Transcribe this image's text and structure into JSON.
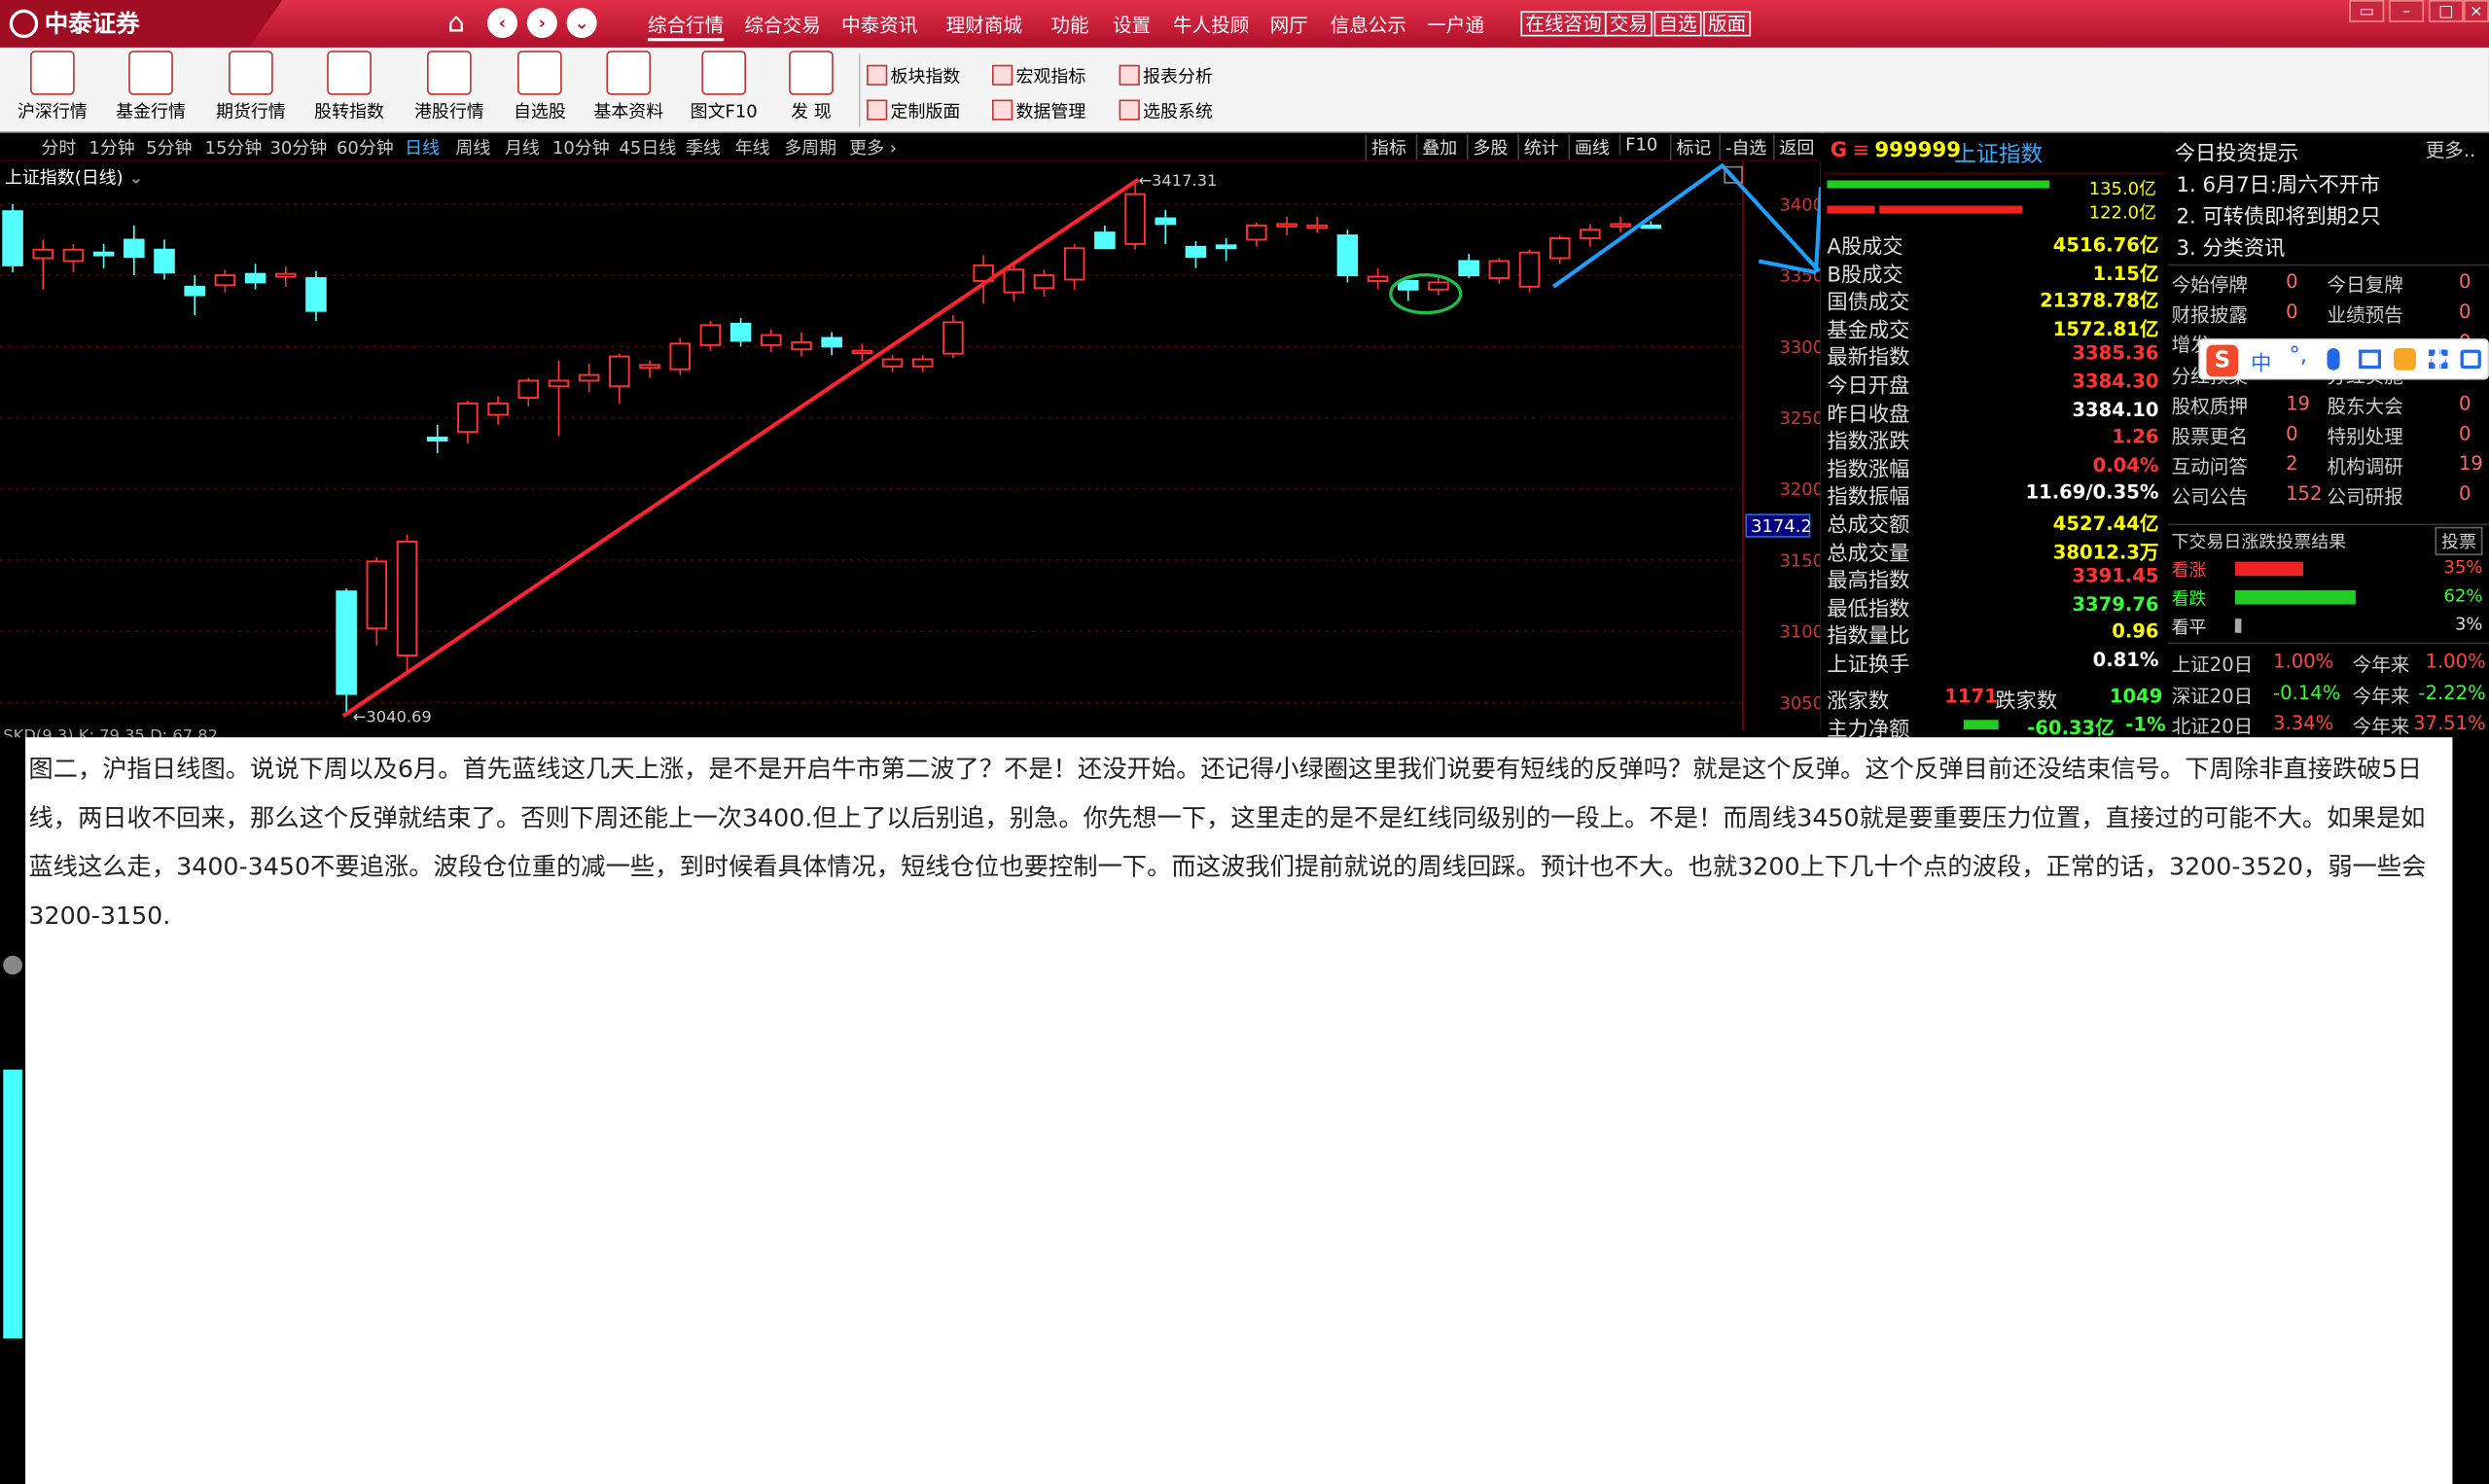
{
  "titlebar": {
    "logo": "中泰证券",
    "menu": [
      "综合行情",
      "综合交易",
      "中泰资讯",
      "理财商城",
      "功能",
      "设置",
      "牛人投顾",
      "网厅",
      "信息公示",
      "一户通"
    ],
    "menu_active": "综合行情",
    "boxes": [
      "在线咨询",
      "交易",
      "自选",
      "版面"
    ],
    "nav_icons": [
      "home-icon",
      "back-icon",
      "forward-icon",
      "dropdown-icon"
    ]
  },
  "toolbar": {
    "items": [
      "沪深行情",
      "基金行情",
      "期货行情",
      "股转指数",
      "港股行情",
      "自选股",
      "基本资料",
      "图文F10",
      "发  现"
    ],
    "items2": [
      "板块指数",
      "宏观指标",
      "报表分析",
      "定制版面",
      "数据管理",
      "选股系统"
    ]
  },
  "chartbar": {
    "timeframes": [
      "分时",
      "1分钟",
      "5分钟",
      "15分钟",
      "30分钟",
      "60分钟",
      "日线",
      "周线",
      "月线",
      "10分钟",
      "45日线",
      "季线",
      "年线",
      "多周期",
      "更多"
    ],
    "active": "日线",
    "tools": [
      "指标",
      "叠加",
      "多股",
      "统计",
      "画线",
      "F10",
      "标记",
      "-自选",
      "返回"
    ]
  },
  "chart": {
    "title": "上证指数(日线)",
    "high_label": "3417.31",
    "low_label": "3040.69",
    "current_price": "3174.2",
    "y_ticks": [
      "3400",
      "3350",
      "3300",
      "3250",
      "3200",
      "3150",
      "3100",
      "3050"
    ],
    "sub_label": "SKD(9,3) K: 79.35 D: 67.82"
  },
  "chart_data": {
    "type": "candlestick",
    "title": "上证指数(日线)",
    "ylim": [
      3030,
      3430
    ],
    "y_ticks": [
      3400,
      3350,
      3300,
      3250,
      3200,
      3150,
      3100,
      3050
    ],
    "candles": [
      [
        3395,
        3357,
        3400,
        3352
      ],
      [
        3362,
        3368,
        3375,
        3340
      ],
      [
        3360,
        3368,
        3372,
        3352
      ],
      [
        3366,
        3364,
        3372,
        3355
      ],
      [
        3375,
        3363,
        3385,
        3350
      ],
      [
        3368,
        3352,
        3375,
        3347
      ],
      [
        3342,
        3336,
        3350,
        3322
      ],
      [
        3343,
        3350,
        3354,
        3338
      ],
      [
        3351,
        3345,
        3358,
        3340
      ],
      [
        3349,
        3351,
        3356,
        3342
      ],
      [
        3348,
        3325,
        3353,
        3318
      ],
      [
        3128,
        3056,
        3130,
        3040.69
      ],
      [
        3102,
        3149,
        3152,
        3090
      ],
      [
        3083,
        3163,
        3168,
        3070
      ],
      [
        3236,
        3234,
        3245,
        3225
      ],
      [
        3240,
        3260,
        3262,
        3232
      ],
      [
        3252,
        3260,
        3265,
        3245
      ],
      [
        3264,
        3276,
        3278,
        3258
      ],
      [
        3272,
        3276,
        3290,
        3237
      ],
      [
        3276,
        3280,
        3288,
        3268
      ],
      [
        3272,
        3293,
        3295,
        3260
      ],
      [
        3285,
        3287,
        3290,
        3278
      ],
      [
        3284,
        3302,
        3306,
        3280
      ],
      [
        3301,
        3315,
        3318,
        3297
      ],
      [
        3316,
        3304,
        3320,
        3300
      ],
      [
        3301,
        3308,
        3312,
        3296
      ],
      [
        3298,
        3303,
        3310,
        3293
      ],
      [
        3306,
        3300,
        3310,
        3294
      ],
      [
        3296,
        3297,
        3302,
        3290
      ],
      [
        3286,
        3291,
        3294,
        3282
      ],
      [
        3286,
        3291,
        3294,
        3282
      ],
      [
        3295,
        3317,
        3322,
        3292
      ],
      [
        3346,
        3357,
        3364,
        3330
      ],
      [
        3338,
        3354,
        3360,
        3332
      ],
      [
        3341,
        3350,
        3354,
        3335
      ],
      [
        3347,
        3369,
        3372,
        3340
      ],
      [
        3380,
        3369,
        3385,
        3374
      ],
      [
        3372,
        3407,
        3417.31,
        3368
      ],
      [
        3390,
        3386,
        3396,
        3372
      ],
      [
        3370,
        3363,
        3374,
        3355
      ],
      [
        3371,
        3369,
        3376,
        3360
      ],
      [
        3375,
        3385,
        3387,
        3370
      ],
      [
        3385,
        3386,
        3391,
        3378
      ],
      [
        3384,
        3385,
        3391,
        3380
      ],
      [
        3378,
        3350,
        3382,
        3345
      ],
      [
        3346,
        3349,
        3355,
        3340
      ],
      [
        3346,
        3340,
        3346,
        3332
      ],
      [
        3340,
        3345,
        3349,
        3336
      ],
      [
        3360,
        3350,
        3365,
        3348
      ],
      [
        3348,
        3360,
        3362,
        3344
      ],
      [
        3342,
        3366,
        3368,
        3338
      ],
      [
        3362,
        3376,
        3378,
        3358
      ],
      [
        3376,
        3382,
        3386,
        3370
      ],
      [
        3385,
        3386,
        3391,
        3380
      ],
      [
        3385,
        3384,
        3388,
        3383
      ]
    ]
  },
  "info": {
    "code": "999999",
    "name": "上证指数",
    "bar1": "135.0亿",
    "bar2": "122.0亿",
    "rows": [
      [
        "A股成交",
        "4516.76亿",
        "#ff0"
      ],
      [
        "B股成交",
        "1.15亿",
        "#ff0"
      ],
      [
        "国债成交",
        "21378.78亿",
        "#ff0"
      ],
      [
        "基金成交",
        "1572.81亿",
        "#ff0"
      ],
      [
        "最新指数",
        "3385.36",
        "#f33"
      ],
      [
        "今日开盘",
        "3384.30",
        "#f33"
      ],
      [
        "昨日收盘",
        "3384.10",
        "#fff"
      ],
      [
        "指数涨跌",
        "1.26",
        "#f33"
      ],
      [
        "指数涨幅",
        "0.04%",
        "#f33"
      ],
      [
        "指数振幅",
        "11.69/0.35%",
        "#fff"
      ],
      [
        "总成交额",
        "4527.44亿",
        "#ff0"
      ],
      [
        "总成交量",
        "38012.3万",
        "#ff0"
      ],
      [
        "最高指数",
        "3391.45",
        "#f33"
      ],
      [
        "最低指数",
        "3379.76",
        "#3f3"
      ],
      [
        "指数量比",
        "0.96",
        "#ff0"
      ],
      [
        "上证换手",
        "0.81%",
        "#fff"
      ]
    ],
    "up_label": "涨家数",
    "up_count": "1171",
    "down_label": "跌家数",
    "down_count": "1049",
    "flow_label": "主力净额",
    "flow_value": "-60.33亿",
    "flow_pct": "-1%"
  },
  "right": {
    "title": "今日投资提示",
    "more": "更多..",
    "tips": [
      "1. 6月7日:周六不开市",
      "2. 可转债即将到期2只",
      "3. 分类资讯"
    ],
    "stats": [
      [
        "今始停牌",
        "0",
        "今日复牌",
        "0"
      ],
      [
        "财报披露",
        "0",
        "业绩预告",
        "0"
      ],
      [
        "增发",
        "",
        "",
        "0"
      ],
      [
        "分红预案",
        "",
        "分红实施",
        "0"
      ],
      [
        "股权质押",
        "19",
        "股东大会",
        "0"
      ],
      [
        "股票更名",
        "0",
        "特别处理",
        "0"
      ],
      [
        "互动问答",
        "2",
        "机构调研",
        "19"
      ],
      [
        "公司公告",
        "152",
        "公司研报",
        "0"
      ]
    ],
    "vote_title": "下交易日涨跌投票结果",
    "vote_btn": "投票",
    "votes": [
      [
        "看涨",
        "35%",
        0.35
      ],
      [
        "看跌",
        "62%",
        0.62
      ],
      [
        "看平",
        "3%",
        0.03
      ]
    ],
    "indices": [
      [
        "上证20日",
        "1.00%",
        "今年来",
        "1.00%"
      ],
      [
        "深证20日",
        "-0.14%",
        "今年来",
        "-2.22%"
      ],
      [
        "北证20日",
        "3.34%",
        "今年来",
        "37.51%"
      ]
    ]
  },
  "ime": {
    "label": "中"
  },
  "overlay": {
    "text": "图二，沪指日线图。说说下周以及6月。首先蓝线这几天上涨，是不是开启牛市第二波了？不是！还没开始。还记得小绿圈这里我们说要有短线的反弹吗？就是这个反弹。这个反弹目前还没结束信号。下周除非直接跌破5日线，两日收不回来，那么这个反弹就结束了。否则下周还能上一次3400.但上了以后别追，别急。你先想一下，这里走的是不是红线同级别的一段上。不是！而周线3450就是要重要压力位置，直接过的可能不大。如果是如蓝线这么走，3400-3450不要追涨。波段仓位重的减一些，到时候看具体情况，短线仓位也要控制一下。而这波我们提前就说的周线回踩。预计也不大。也就3200上下几十个点的波段，正常的话，3200-3520，弱一些会3200-3150."
  },
  "colors": {
    "up": "#ff3333",
    "down": "#54ffff",
    "redline": "#ff2233",
    "blueline": "#1ca0ff",
    "circle": "#1cc04c"
  }
}
